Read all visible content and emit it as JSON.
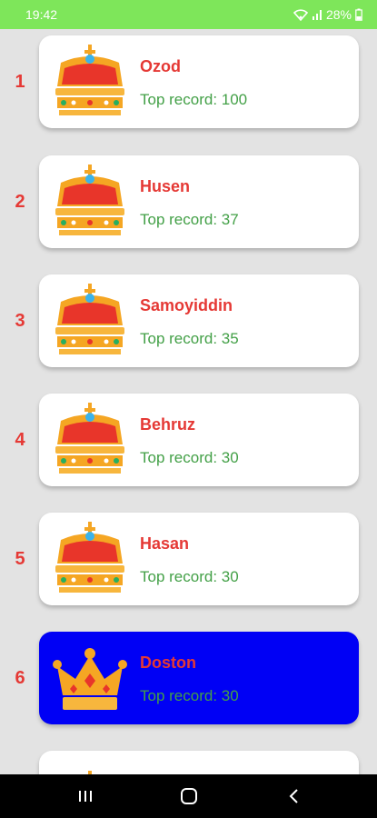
{
  "status_bar": {
    "time": "19:42",
    "battery": "28%",
    "icons": [
      "wifi-icon",
      "signal-icon",
      "battery-icon"
    ]
  },
  "leaderboard": [
    {
      "rank": "1",
      "name": "Ozod",
      "record": "Top record: 100",
      "highlighted": false
    },
    {
      "rank": "2",
      "name": "Husen",
      "record": "Top record: 37",
      "highlighted": false
    },
    {
      "rank": "3",
      "name": "Samoyiddin",
      "record": "Top record: 35",
      "highlighted": false
    },
    {
      "rank": "4",
      "name": "Behruz",
      "record": "Top record: 30",
      "highlighted": false
    },
    {
      "rank": "5",
      "name": "Hasan",
      "record": "Top record: 30",
      "highlighted": false
    },
    {
      "rank": "6",
      "name": "Doston",
      "record": "Top record: 30",
      "highlighted": true
    }
  ],
  "colors": {
    "status_bar": "#7ee65a",
    "rank_text": "#e53935",
    "name_text": "#e53935",
    "record_text": "#43a047",
    "highlight_card": "#0000f5",
    "card": "#ffffff",
    "background": "#e3e3e3"
  },
  "nav_bar": {
    "buttons": [
      "recents-icon",
      "home-icon",
      "back-icon"
    ]
  }
}
